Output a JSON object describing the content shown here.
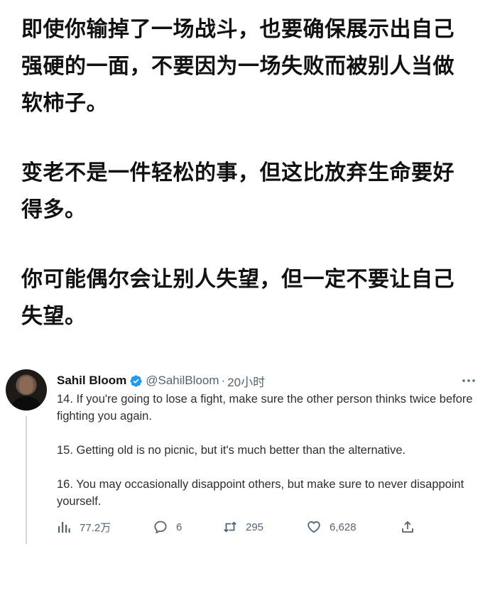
{
  "quotes": [
    "即使你输掉了一场战斗，也要确保展示出自己强硬的一面，不要因为一场失败而被别人当做软柿子。",
    "变老不是一件轻松的事，但这比放弃生命要好得多。",
    "你可能偶尔会让别人失望，但一定不要让自己失望。"
  ],
  "tweet": {
    "author_name": "Sahil Bloom",
    "handle": "@SahilBloom",
    "separator": "·",
    "time": "20小时",
    "paragraphs": [
      "14. If you're going to lose a fight, make sure the other person thinks twice before fighting you again.",
      "15. Getting old is no picnic, but it's much better than the alternative.",
      "16. You may occasionally disappoint others, but make sure to never disappoint yourself."
    ],
    "stats": {
      "views": "77.2万",
      "replies": "6",
      "retweets": "295",
      "likes": "6,628"
    }
  },
  "icons": {
    "verified": "verified-badge-icon",
    "more": "more-options-icon",
    "views": "views-bar-chart-icon",
    "reply": "reply-bubble-icon",
    "retweet": "retweet-icon",
    "like": "heart-icon",
    "share": "share-upload-icon"
  },
  "colors": {
    "verified_blue": "#1d9bf0",
    "muted_text": "#536471",
    "main_text": "#111111"
  }
}
